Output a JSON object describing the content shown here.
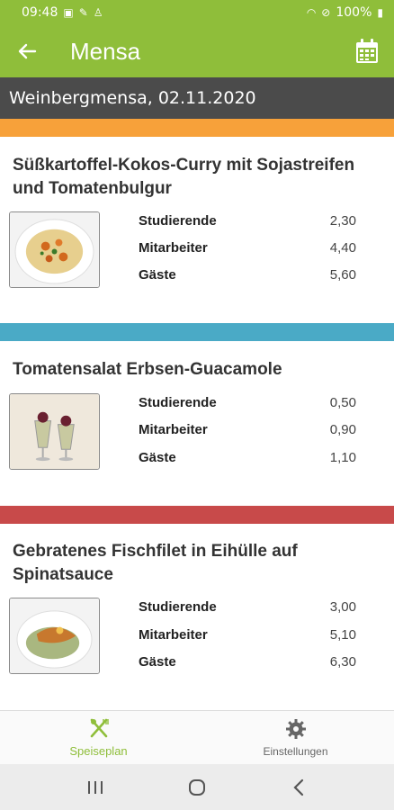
{
  "status_bar": {
    "time": "09:48",
    "battery": "100%"
  },
  "app_bar": {
    "title": "Mensa"
  },
  "location": {
    "label": "Weinbergmensa, 02.11.2020"
  },
  "meals": [
    {
      "title": "Süßkartoffel-Kokos-Curry mit Sojastreifen und Tomatenbulgur",
      "color": "#f7a13a",
      "prices": [
        {
          "label": "Studierende",
          "value": "2,30"
        },
        {
          "label": "Mitarbeiter",
          "value": "4,40"
        },
        {
          "label": "Gäste",
          "value": "5,60"
        }
      ]
    },
    {
      "title": "Tomatensalat Erbsen-Guacamole",
      "color": "#4aaac6",
      "prices": [
        {
          "label": "Studierende",
          "value": "0,50"
        },
        {
          "label": "Mitarbeiter",
          "value": "0,90"
        },
        {
          "label": "Gäste",
          "value": "1,10"
        }
      ]
    },
    {
      "title": "Gebratenes Fischfilet in Eihülle auf Spinatsauce",
      "color": "#c84a4a",
      "prices": [
        {
          "label": "Studierende",
          "value": "3,00"
        },
        {
          "label": "Mitarbeiter",
          "value": "5,10"
        },
        {
          "label": "Gäste",
          "value": "6,30"
        }
      ]
    }
  ],
  "bottom_nav": {
    "items": [
      {
        "label": "Speiseplan",
        "icon": "cutlery-icon",
        "active": true
      },
      {
        "label": "Einstellungen",
        "icon": "gear-icon",
        "active": false
      }
    ]
  },
  "colors": {
    "brand_green": "#8fbe3a",
    "location_bar": "#4b4b4b"
  }
}
